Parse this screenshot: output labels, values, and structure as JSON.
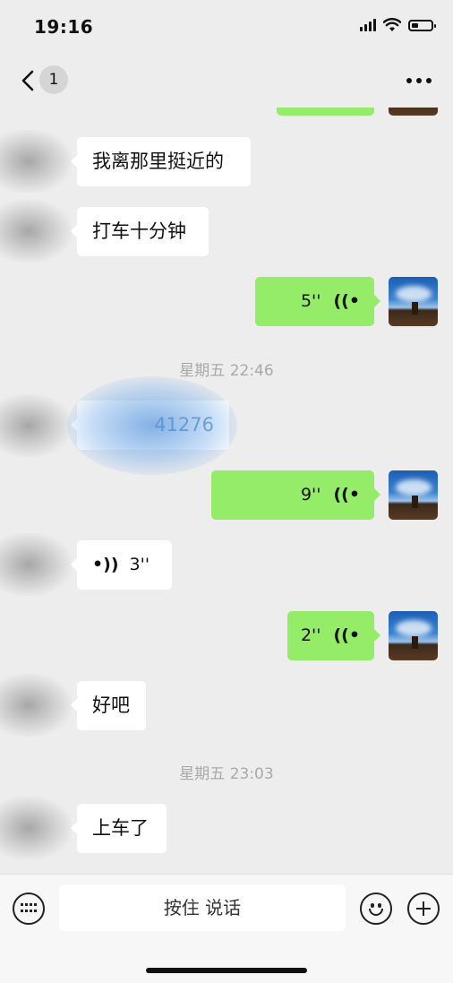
{
  "status_bar": {
    "time": "19:16",
    "battery_level": 0.35
  },
  "nav": {
    "unread_count": "1"
  },
  "colors": {
    "outgoing_bubble": "#95ec69",
    "incoming_bubble": "#ffffff",
    "background": "#ededed"
  },
  "messages": [
    {
      "side": "in",
      "type": "text",
      "text": "我离那里挺近的"
    },
    {
      "side": "in",
      "type": "text",
      "text": "打车十分钟"
    },
    {
      "side": "out",
      "type": "voice",
      "duration": "5''"
    },
    {
      "type": "time",
      "text": "星期五 22:46"
    },
    {
      "side": "in",
      "type": "text",
      "text": "41276"
    },
    {
      "side": "out",
      "type": "voice",
      "duration": "9''"
    },
    {
      "side": "in",
      "type": "voice",
      "duration": "3''"
    },
    {
      "side": "out",
      "type": "voice",
      "duration": "2''"
    },
    {
      "side": "in",
      "type": "text",
      "text": "好吧"
    },
    {
      "type": "time",
      "text": "星期五 23:03"
    },
    {
      "side": "in",
      "type": "text",
      "text": "上车了"
    }
  ],
  "input_bar": {
    "hold_to_talk_label": "按住 说话"
  },
  "icons": [
    "back-icon",
    "more-icon",
    "voice-wave-icon",
    "keyboard-icon",
    "emoji-icon",
    "plus-icon"
  ]
}
